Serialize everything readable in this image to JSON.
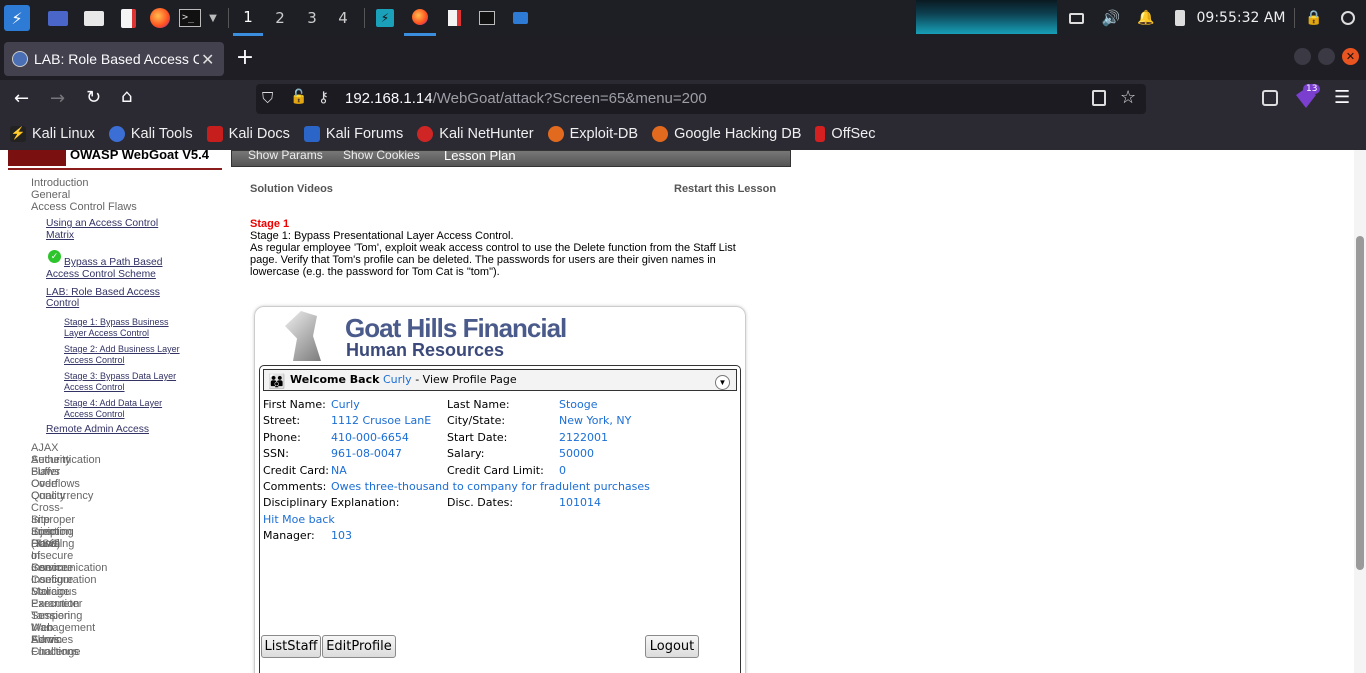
{
  "taskbar": {
    "workspaces": [
      "1",
      "2",
      "3",
      "4"
    ],
    "clock": "09:55:32 AM"
  },
  "browser": {
    "tab_title": "LAB: Role Based Access C",
    "url_host": "192.168.1.14",
    "url_path": "/WebGoat/attack?Screen=65&menu=200",
    "extension_badge": "13",
    "bookmarks": [
      "Kali Linux",
      "Kali Tools",
      "Kali Docs",
      "Kali Forums",
      "Kali NetHunter",
      "Exploit-DB",
      "Google Hacking DB",
      "OffSec"
    ]
  },
  "header": {
    "logo_text": "OWASP WebGoat  V5.4",
    "show_params": "Show Params",
    "show_cookies": "Show Cookies",
    "lesson_plan": "Lesson Plan"
  },
  "sidebar": {
    "introduction": "Introduction",
    "general": "General",
    "access_control_flaws": "Access Control Flaws",
    "using_acm_1": "Using an Access Control",
    "using_acm_2": "Matrix",
    "bypass_path_1": "Bypass a Path Based",
    "bypass_path_2": "Access Control Scheme",
    "lab_rbac_1": "LAB: Role Based Access",
    "lab_rbac_2": "Control",
    "stage1_1": "Stage 1: Bypass Business",
    "stage1_2": "Layer Access Control",
    "stage2_1": "Stage 2: Add Business Layer",
    "stage2_2": "Access Control",
    "stage3_1": "Stage 3: Bypass Data Layer",
    "stage3_2": "Access Control",
    "stage4_1": "Stage 4: Add Data Layer",
    "stage4_2": "Access Control",
    "remote_admin": "Remote Admin Access",
    "categories": [
      "AJAX Security",
      "Authentication Flaws",
      "Buffer Overflows",
      "Code Quality",
      "Concurrency",
      "Cross-Site Scripting (XSS)",
      "Improper Error Handling",
      "Injection Flaws",
      "Denial of Service",
      "Insecure Communication",
      "Insecure Configuration",
      "Insecure Storage",
      "Malicious Execution",
      "Parameter Tampering",
      "Session Management Flaws",
      "Web Services",
      "Admin Functions",
      "Challenge"
    ]
  },
  "lesson": {
    "solution_videos": "Solution Videos",
    "restart": "Restart this Lesson",
    "stage_title": "Stage 1",
    "stage_line": "Stage 1: Bypass Presentational Layer Access Control.",
    "desc_1": "As regular employee 'Tom', exploit weak access control to use the Delete function from the Staff List",
    "desc_2": "page. Verify that Tom's profile can be deleted. The passwords for users are their given names in",
    "desc_3": "lowercase (e.g. the password for Tom Cat is \"tom\")."
  },
  "app": {
    "company": "Goat Hills Financial",
    "department": "Human Resources",
    "welcome": "Welcome Back",
    "user": "Curly",
    "page_suffix": " - View Profile Page",
    "fields": {
      "first_name_label": "First Name:",
      "first_name": "Curly",
      "last_name_label": "Last Name:",
      "last_name": "Stooge",
      "street_label": "Street:",
      "street": "1112 Crusoe LanE",
      "city_label": "City/State:",
      "city": "New York, NY",
      "phone_label": "Phone:",
      "phone": "410-000-6654",
      "start_label": "Start Date:",
      "start": "2122001",
      "ssn_label": "SSN:",
      "ssn": "961-08-0047",
      "salary_label": "Salary:",
      "salary": "50000",
      "cc_label": "Credit Card:",
      "cc": "NA",
      "cc_limit_label": "Credit Card Limit:",
      "cc_limit": "0",
      "comments_label": "Comments:",
      "comments": "Owes three-thousand to company for fradulent purchases",
      "disc_label": "Disciplinary Explanation:",
      "disc_dates_label": "Disc. Dates:",
      "disc_dates": "101014",
      "disc_text": "Hit Moe back",
      "manager_label": "Manager:",
      "manager": "103"
    },
    "buttons": {
      "list_staff": "ListStaff",
      "edit_profile": "EditProfile",
      "logout": "Logout"
    }
  }
}
